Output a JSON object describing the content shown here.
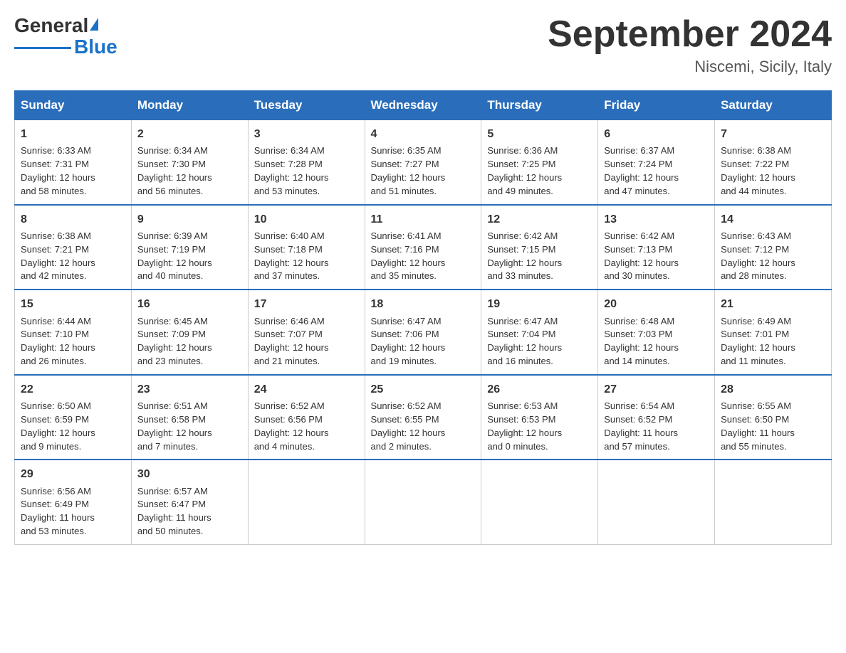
{
  "header": {
    "logo_general": "General",
    "logo_blue": "Blue",
    "month_title": "September 2024",
    "location": "Niscemi, Sicily, Italy"
  },
  "weekdays": [
    "Sunday",
    "Monday",
    "Tuesday",
    "Wednesday",
    "Thursday",
    "Friday",
    "Saturday"
  ],
  "weeks": [
    [
      {
        "day": 1,
        "sunrise": "6:33 AM",
        "sunset": "7:31 PM",
        "daylight": "12 hours and 58 minutes."
      },
      {
        "day": 2,
        "sunrise": "6:34 AM",
        "sunset": "7:30 PM",
        "daylight": "12 hours and 56 minutes."
      },
      {
        "day": 3,
        "sunrise": "6:34 AM",
        "sunset": "7:28 PM",
        "daylight": "12 hours and 53 minutes."
      },
      {
        "day": 4,
        "sunrise": "6:35 AM",
        "sunset": "7:27 PM",
        "daylight": "12 hours and 51 minutes."
      },
      {
        "day": 5,
        "sunrise": "6:36 AM",
        "sunset": "7:25 PM",
        "daylight": "12 hours and 49 minutes."
      },
      {
        "day": 6,
        "sunrise": "6:37 AM",
        "sunset": "7:24 PM",
        "daylight": "12 hours and 47 minutes."
      },
      {
        "day": 7,
        "sunrise": "6:38 AM",
        "sunset": "7:22 PM",
        "daylight": "12 hours and 44 minutes."
      }
    ],
    [
      {
        "day": 8,
        "sunrise": "6:38 AM",
        "sunset": "7:21 PM",
        "daylight": "12 hours and 42 minutes."
      },
      {
        "day": 9,
        "sunrise": "6:39 AM",
        "sunset": "7:19 PM",
        "daylight": "12 hours and 40 minutes."
      },
      {
        "day": 10,
        "sunrise": "6:40 AM",
        "sunset": "7:18 PM",
        "daylight": "12 hours and 37 minutes."
      },
      {
        "day": 11,
        "sunrise": "6:41 AM",
        "sunset": "7:16 PM",
        "daylight": "12 hours and 35 minutes."
      },
      {
        "day": 12,
        "sunrise": "6:42 AM",
        "sunset": "7:15 PM",
        "daylight": "12 hours and 33 minutes."
      },
      {
        "day": 13,
        "sunrise": "6:42 AM",
        "sunset": "7:13 PM",
        "daylight": "12 hours and 30 minutes."
      },
      {
        "day": 14,
        "sunrise": "6:43 AM",
        "sunset": "7:12 PM",
        "daylight": "12 hours and 28 minutes."
      }
    ],
    [
      {
        "day": 15,
        "sunrise": "6:44 AM",
        "sunset": "7:10 PM",
        "daylight": "12 hours and 26 minutes."
      },
      {
        "day": 16,
        "sunrise": "6:45 AM",
        "sunset": "7:09 PM",
        "daylight": "12 hours and 23 minutes."
      },
      {
        "day": 17,
        "sunrise": "6:46 AM",
        "sunset": "7:07 PM",
        "daylight": "12 hours and 21 minutes."
      },
      {
        "day": 18,
        "sunrise": "6:47 AM",
        "sunset": "7:06 PM",
        "daylight": "12 hours and 19 minutes."
      },
      {
        "day": 19,
        "sunrise": "6:47 AM",
        "sunset": "7:04 PM",
        "daylight": "12 hours and 16 minutes."
      },
      {
        "day": 20,
        "sunrise": "6:48 AM",
        "sunset": "7:03 PM",
        "daylight": "12 hours and 14 minutes."
      },
      {
        "day": 21,
        "sunrise": "6:49 AM",
        "sunset": "7:01 PM",
        "daylight": "12 hours and 11 minutes."
      }
    ],
    [
      {
        "day": 22,
        "sunrise": "6:50 AM",
        "sunset": "6:59 PM",
        "daylight": "12 hours and 9 minutes."
      },
      {
        "day": 23,
        "sunrise": "6:51 AM",
        "sunset": "6:58 PM",
        "daylight": "12 hours and 7 minutes."
      },
      {
        "day": 24,
        "sunrise": "6:52 AM",
        "sunset": "6:56 PM",
        "daylight": "12 hours and 4 minutes."
      },
      {
        "day": 25,
        "sunrise": "6:52 AM",
        "sunset": "6:55 PM",
        "daylight": "12 hours and 2 minutes."
      },
      {
        "day": 26,
        "sunrise": "6:53 AM",
        "sunset": "6:53 PM",
        "daylight": "12 hours and 0 minutes."
      },
      {
        "day": 27,
        "sunrise": "6:54 AM",
        "sunset": "6:52 PM",
        "daylight": "11 hours and 57 minutes."
      },
      {
        "day": 28,
        "sunrise": "6:55 AM",
        "sunset": "6:50 PM",
        "daylight": "11 hours and 55 minutes."
      }
    ],
    [
      {
        "day": 29,
        "sunrise": "6:56 AM",
        "sunset": "6:49 PM",
        "daylight": "11 hours and 53 minutes."
      },
      {
        "day": 30,
        "sunrise": "6:57 AM",
        "sunset": "6:47 PM",
        "daylight": "11 hours and 50 minutes."
      },
      null,
      null,
      null,
      null,
      null
    ]
  ],
  "labels": {
    "sunrise": "Sunrise:",
    "sunset": "Sunset:",
    "daylight": "Daylight:"
  }
}
